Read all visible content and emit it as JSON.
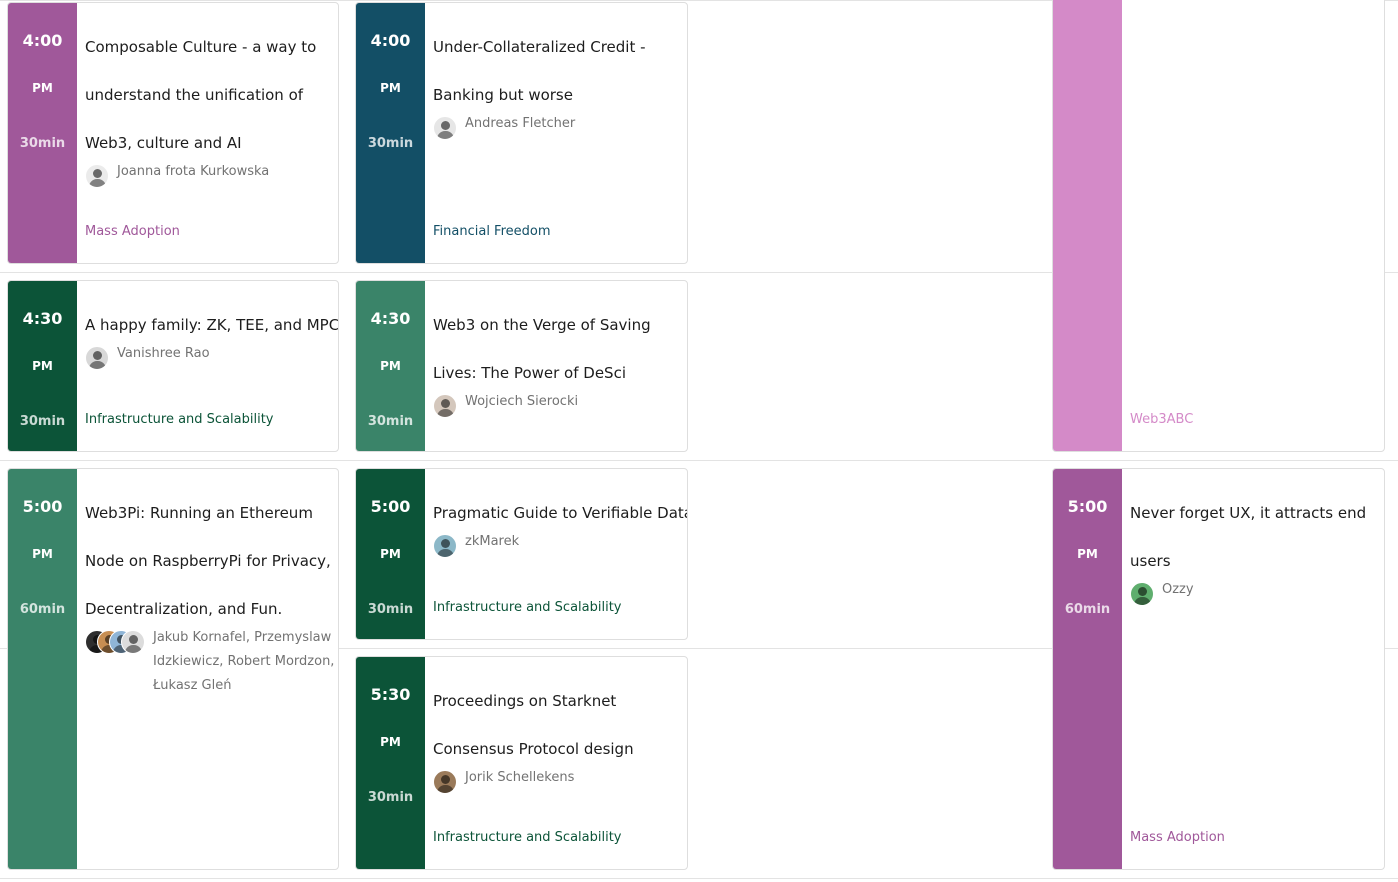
{
  "colors": {
    "mass_adoption": "#a0589a",
    "financial_freedom": "#134f66",
    "infra_dark": "#0c5438",
    "infra_green": "#3a8469",
    "web3abc": "#d48ac8"
  },
  "sessions": [
    {
      "time": "4:00",
      "ampm": "PM",
      "duration": "30min",
      "title": [
        "Composable Culture - a way to",
        "understand the unification of",
        "Web3, culture and AI"
      ],
      "speakers": "Joanna frota Kurkowska",
      "tag": "Mass Adoption"
    },
    {
      "time": "4:00",
      "ampm": "PM",
      "duration": "30min",
      "title": [
        "Under-Collateralized Credit -",
        "Banking but worse"
      ],
      "speakers": "Andreas Fletcher",
      "tag": "Financial Freedom"
    },
    {
      "time": "4:30",
      "ampm": "PM",
      "duration": "30min",
      "title": [
        "A happy family: ZK, TEE, and MPC!"
      ],
      "speakers": "Vanishree Rao",
      "tag": "Infrastructure and Scalability"
    },
    {
      "time": "4:30",
      "ampm": "PM",
      "duration": "30min",
      "title": [
        "Web3 on the Verge of Saving",
        "Lives: The Power of DeSci"
      ],
      "speakers": "Wojciech Sierocki",
      "tag": ""
    },
    {
      "time": "5:00",
      "ampm": "PM",
      "duration": "60min",
      "title": [
        "Web3Pi: Running an Ethereum",
        "Node on RaspberryPi for Privacy,",
        "Decentralization, and Fun."
      ],
      "speakers": [
        "Jakub Kornafel, Przemyslaw",
        "Idzkiewicz, Robert Mordzon,",
        "Łukasz Gleń"
      ],
      "tag": ""
    },
    {
      "time": "5:00",
      "ampm": "PM",
      "duration": "30min",
      "title": [
        "Pragmatic Guide to Verifiable Data"
      ],
      "speakers": "zkMarek",
      "tag": "Infrastructure and Scalability"
    },
    {
      "time": "5:30",
      "ampm": "PM",
      "duration": "30min",
      "title": [
        "Proceedings on Starknet",
        "Consensus Protocol design"
      ],
      "speakers": "Jorik Schellekens",
      "tag": "Infrastructure and Scalability"
    },
    {
      "time": "",
      "ampm": "",
      "duration": "",
      "title": [],
      "speakers": "",
      "tag": "Web3ABC"
    },
    {
      "time": "5:00",
      "ampm": "PM",
      "duration": "60min",
      "title": [
        "Never forget UX, it attracts end",
        "users"
      ],
      "speakers": "Ozzy",
      "tag": "Mass Adoption"
    }
  ]
}
